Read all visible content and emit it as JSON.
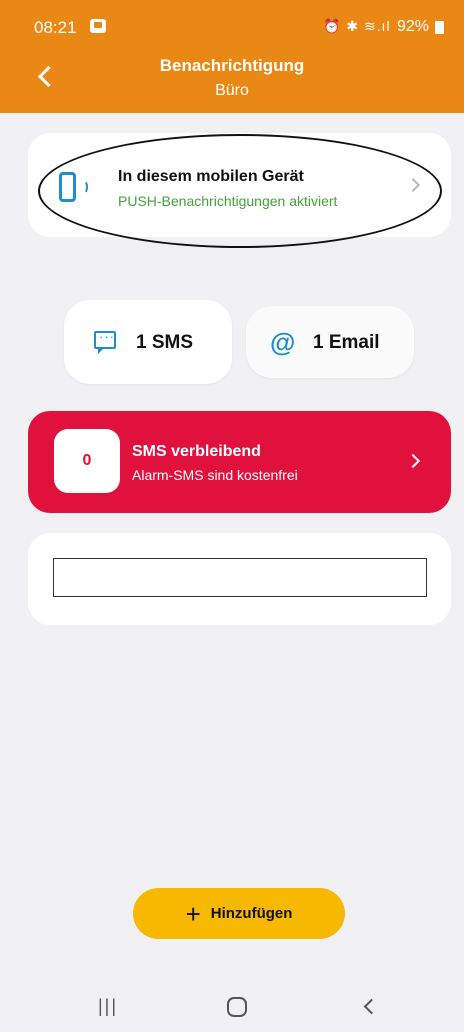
{
  "status_bar": {
    "time": "08:21",
    "icons": "⏰ ✱ ≋.ıl",
    "battery": "92%"
  },
  "header": {
    "title": "Benachrichtigung",
    "subtitle": "Büro",
    "color": "#e98814"
  },
  "device": {
    "title": "In diesem mobilen Gerät",
    "status": "PUSH-Benachrichtigungen aktiviert",
    "status_color": "#44a23a"
  },
  "channels": {
    "sms_label": "1 SMS",
    "email_label": "1 Email",
    "email_symbol": "@"
  },
  "sms_banner": {
    "count": "0",
    "title": "SMS verbleibend",
    "subtitle": "Alarm-SMS sind kostenfrei",
    "color": "#e0113d"
  },
  "input": {
    "value": ""
  },
  "add_button": {
    "label": "Hinzufügen",
    "plus": "+",
    "color": "#f6b800"
  },
  "nav": {
    "recent": "|||"
  }
}
